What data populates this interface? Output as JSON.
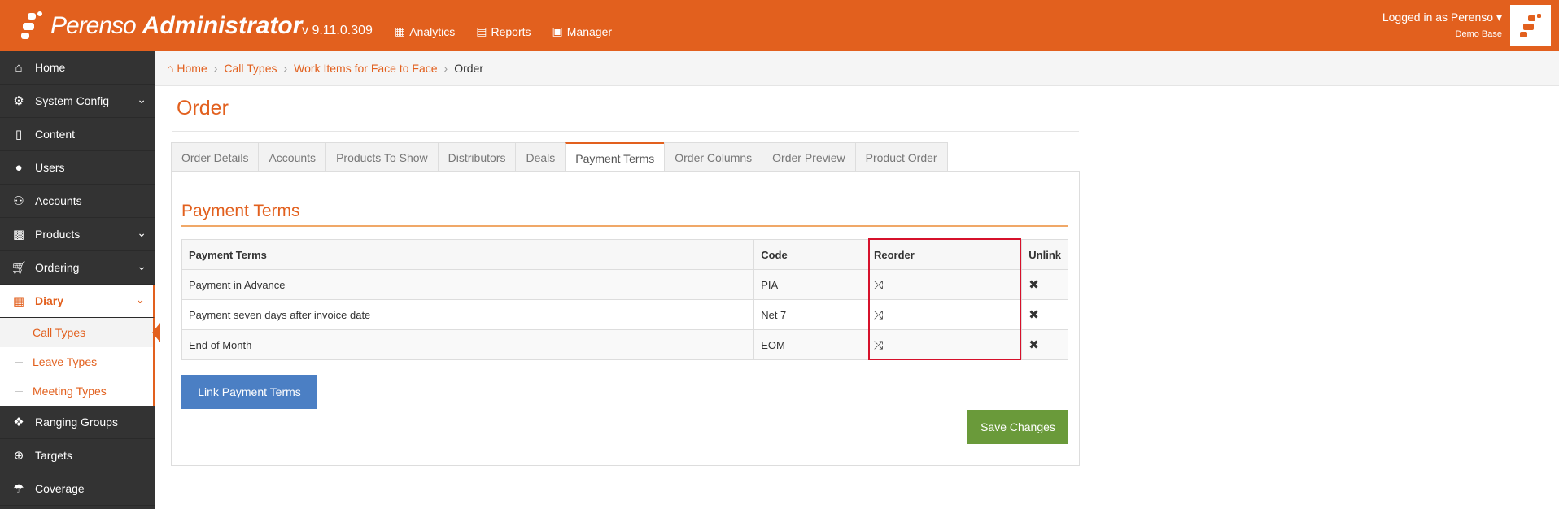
{
  "header": {
    "logo_text": "Perenso",
    "logo_strong": "Administrator",
    "version": "v 9.11.0.309",
    "nav": [
      {
        "label": "Analytics",
        "icon": "chart-icon"
      },
      {
        "label": "Reports",
        "icon": "table-icon"
      },
      {
        "label": "Manager",
        "icon": "briefcase-icon"
      }
    ],
    "user_label": "Logged in as Perenso",
    "user_sub": "Demo Base"
  },
  "sidebar": {
    "items": [
      {
        "label": "Home",
        "icon": "home-icon"
      },
      {
        "label": "System Config",
        "icon": "gear-icon",
        "expandable": true
      },
      {
        "label": "Content",
        "icon": "file-icon"
      },
      {
        "label": "Users",
        "icon": "user-icon"
      },
      {
        "label": "Accounts",
        "icon": "users-icon"
      },
      {
        "label": "Products",
        "icon": "gift-icon",
        "expandable": true
      },
      {
        "label": "Ordering",
        "icon": "cart-icon",
        "expandable": true
      },
      {
        "label": "Diary",
        "icon": "calendar-icon",
        "expandable": true,
        "active": true
      },
      {
        "label": "Ranging Groups",
        "icon": "cubes-icon"
      },
      {
        "label": "Targets",
        "icon": "crosshair-icon"
      },
      {
        "label": "Coverage",
        "icon": "umbrella-icon"
      }
    ],
    "diary_sub": [
      "Call Types",
      "Leave Types",
      "Meeting Types"
    ]
  },
  "breadcrumb": {
    "home": "Home",
    "call_types": "Call Types",
    "work_items": "Work Items for Face to Face",
    "current": "Order"
  },
  "page": {
    "title": "Order",
    "tabs": [
      "Order Details",
      "Accounts",
      "Products To Show",
      "Distributors",
      "Deals",
      "Payment Terms",
      "Order Columns",
      "Order Preview",
      "Product Order"
    ],
    "active_tab": "Payment Terms",
    "section_title": "Payment Terms"
  },
  "table": {
    "headers": [
      "Payment Terms",
      "Code",
      "Reorder",
      "Unlink"
    ],
    "rows": [
      {
        "term": "Payment in Advance",
        "code": "PIA"
      },
      {
        "term": "Payment seven days after invoice date",
        "code": "Net 7"
      },
      {
        "term": "End of Month",
        "code": "EOM"
      }
    ]
  },
  "buttons": {
    "link": "Link Payment Terms",
    "save": "Save Changes"
  },
  "colors": {
    "brand": "#e2601e",
    "link_button": "#4b7fc4",
    "save_button": "#6a9a3a",
    "highlight": "#d6112b"
  }
}
